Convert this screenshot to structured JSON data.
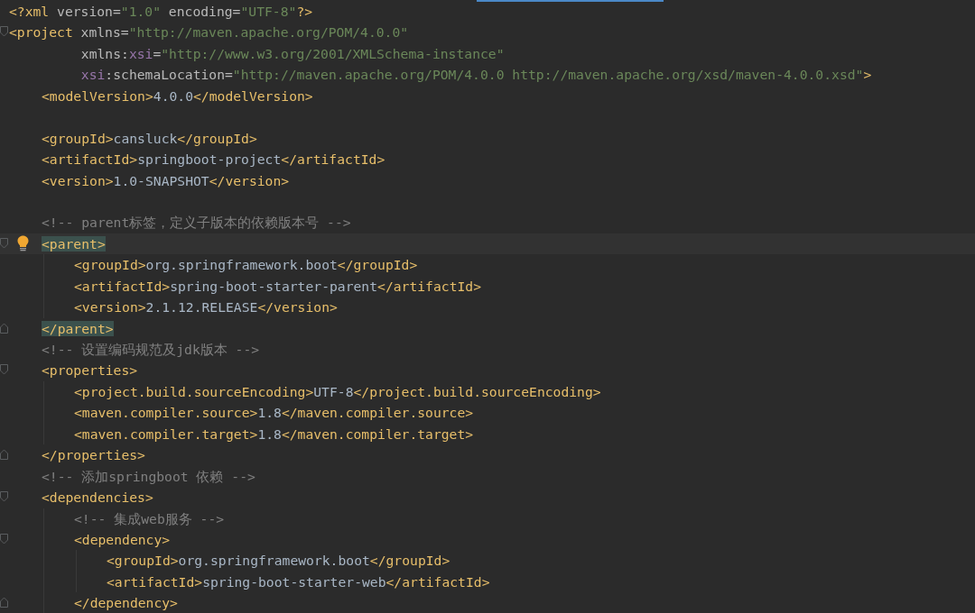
{
  "editor": {
    "lines": [
      {
        "segments": [
          {
            "kind": "tag",
            "text": "<?xml"
          },
          {
            "kind": "attr",
            "text": " version="
          },
          {
            "kind": "string",
            "text": "\"1.0\""
          },
          {
            "kind": "attr",
            "text": " encoding="
          },
          {
            "kind": "string",
            "text": "\"UTF-8\""
          },
          {
            "kind": "tag",
            "text": "?>"
          }
        ]
      },
      {
        "segments": [
          {
            "kind": "tag",
            "text": "<project"
          },
          {
            "kind": "attr",
            "text": " xmlns="
          },
          {
            "kind": "string",
            "text": "\"http://maven.apache.org/POM/4.0.0\""
          }
        ],
        "continuation": [
          [
            {
              "kind": "attr",
              "text": "xmlns:"
            },
            {
              "kind": "ns",
              "text": "xsi"
            },
            {
              "kind": "attr",
              "text": "="
            },
            {
              "kind": "string",
              "text": "\"http://www.w3.org/2001/XMLSchema-instance\""
            }
          ],
          [
            {
              "kind": "ns",
              "text": "xsi"
            },
            {
              "kind": "attr",
              "text": ":schemaLocation="
            },
            {
              "kind": "string",
              "text": "\"http://maven.apache.org/POM/4.0.0 http://maven.apache.org/xsd/maven-4.0.0.xsd\""
            },
            {
              "kind": "tag",
              "text": ">"
            }
          ]
        ],
        "children": [
          {
            "segments": [
              {
                "kind": "tag",
                "text": "<modelVersion>"
              },
              {
                "kind": "text",
                "text": "4.0.0"
              },
              {
                "kind": "tag",
                "text": "</modelVersion>"
              }
            ]
          },
          {
            "blank_line_before": true,
            "segments": [
              {
                "kind": "tag",
                "text": "<groupId>"
              },
              {
                "kind": "text",
                "text": "cansluck"
              },
              {
                "kind": "tag",
                "text": "</groupId>"
              }
            ]
          },
          {
            "segments": [
              {
                "kind": "tag",
                "text": "<artifactId>"
              },
              {
                "kind": "text",
                "text": "springboot-project"
              },
              {
                "kind": "tag",
                "text": "</artifactId>"
              }
            ]
          },
          {
            "segments": [
              {
                "kind": "tag",
                "text": "<version>"
              },
              {
                "kind": "text",
                "text": "1.0-SNAPSHOT"
              },
              {
                "kind": "tag",
                "text": "</version>"
              }
            ]
          },
          {
            "blank_line_before": true,
            "segments": [
              {
                "kind": "comment",
                "text": "<!-- parent标签，定义子版本的依赖版本号 -->"
              }
            ]
          },
          {
            "segments": [
              {
                "kind": "tag",
                "text": "<parent>",
                "matched": true
              }
            ],
            "caret": true,
            "bulb": true,
            "children": [
              {
                "segments": [
                  {
                    "kind": "tag",
                    "text": "<groupId>"
                  },
                  {
                    "kind": "text",
                    "text": "org.springframework.boot"
                  },
                  {
                    "kind": "tag",
                    "text": "</groupId>"
                  }
                ]
              },
              {
                "segments": [
                  {
                    "kind": "tag",
                    "text": "<artifactId>"
                  },
                  {
                    "kind": "text",
                    "text": "spring-boot-starter-parent"
                  },
                  {
                    "kind": "tag",
                    "text": "</artifactId>"
                  }
                ]
              },
              {
                "segments": [
                  {
                    "kind": "tag",
                    "text": "<version>"
                  },
                  {
                    "kind": "text",
                    "text": "2.1.12.RELEASE"
                  },
                  {
                    "kind": "tag",
                    "text": "</version>"
                  }
                ]
              }
            ],
            "closing": [
              {
                "kind": "tag",
                "text": "</parent>",
                "matched": true
              }
            ]
          },
          {
            "segments": [
              {
                "kind": "comment",
                "text": "<!-- 设置编码规范及jdk版本 -->"
              }
            ]
          },
          {
            "segments": [
              {
                "kind": "tag",
                "text": "<properties>"
              }
            ],
            "children": [
              {
                "segments": [
                  {
                    "kind": "tag",
                    "text": "<project.build.sourceEncoding>"
                  },
                  {
                    "kind": "text",
                    "text": "UTF-8"
                  },
                  {
                    "kind": "tag",
                    "text": "</project.build.sourceEncoding>"
                  }
                ]
              },
              {
                "segments": [
                  {
                    "kind": "tag",
                    "text": "<maven.compiler.source>"
                  },
                  {
                    "kind": "text",
                    "text": "1.8"
                  },
                  {
                    "kind": "tag",
                    "text": "</maven.compiler.source>"
                  }
                ]
              },
              {
                "segments": [
                  {
                    "kind": "tag",
                    "text": "<maven.compiler.target>"
                  },
                  {
                    "kind": "text",
                    "text": "1.8"
                  },
                  {
                    "kind": "tag",
                    "text": "</maven.compiler.target>"
                  }
                ]
              }
            ],
            "closing": [
              {
                "kind": "tag",
                "text": "</properties>"
              }
            ]
          },
          {
            "segments": [
              {
                "kind": "comment",
                "text": "<!-- 添加springboot 依赖 -->"
              }
            ]
          },
          {
            "segments": [
              {
                "kind": "tag",
                "text": "<dependencies>"
              }
            ],
            "children": [
              {
                "segments": [
                  {
                    "kind": "comment",
                    "text": "<!-- 集成web服务 -->"
                  }
                ]
              },
              {
                "segments": [
                  {
                    "kind": "tag",
                    "text": "<dependency>"
                  }
                ],
                "children": [
                  {
                    "segments": [
                      {
                        "kind": "tag",
                        "text": "<groupId>"
                      },
                      {
                        "kind": "text",
                        "text": "org.springframework.boot"
                      },
                      {
                        "kind": "tag",
                        "text": "</groupId>"
                      }
                    ]
                  },
                  {
                    "segments": [
                      {
                        "kind": "tag",
                        "text": "<artifactId>"
                      },
                      {
                        "kind": "text",
                        "text": "spring-boot-starter-web"
                      },
                      {
                        "kind": "tag",
                        "text": "</artifactId>"
                      }
                    ]
                  }
                ],
                "closing": [
                  {
                    "kind": "tag",
                    "text": "</dependency>"
                  }
                ]
              }
            ]
          }
        ]
      }
    ]
  }
}
